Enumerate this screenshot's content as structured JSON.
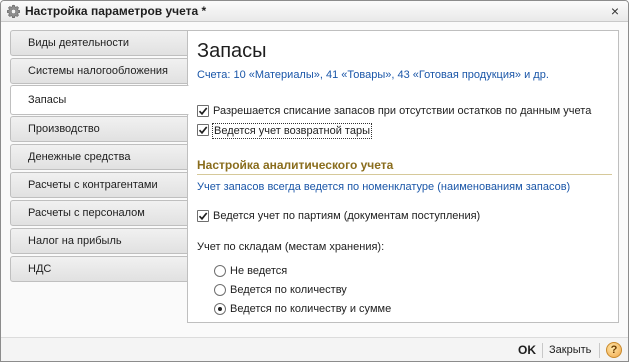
{
  "window": {
    "title": "Настройка параметров учета *",
    "close_glyph": "×"
  },
  "tabs": [
    {
      "label": "Виды деятельности",
      "active": false
    },
    {
      "label": "Системы налогообложения",
      "active": false
    },
    {
      "label": "Запасы",
      "active": true
    },
    {
      "label": "Производство",
      "active": false
    },
    {
      "label": "Денежные средства",
      "active": false
    },
    {
      "label": "Расчеты с контрагентами",
      "active": false
    },
    {
      "label": "Расчеты с персоналом",
      "active": false
    },
    {
      "label": "Налог на прибыль",
      "active": false
    },
    {
      "label": "НДС",
      "active": false
    }
  ],
  "panel": {
    "title": "Запасы",
    "accounts_link": "Счета: 10 «Материалы», 41 «Товары», 43 «Готовая продукция» и др.",
    "checkbox_write_off": {
      "label": "Разрешается списание запасов при отсутствии остатков по данным учета",
      "checked": true
    },
    "checkbox_returnable": {
      "label": "Ведется учет возвратной тары",
      "checked": true
    },
    "section_title": "Настройка аналитического учета",
    "info_text": "Учет запасов всегда ведется по номенклатуре (наименованиям запасов)",
    "checkbox_batches": {
      "label": "Ведется учет по партиям (документам поступления)",
      "checked": true
    },
    "warehouse_group_label": "Учет по складам (местам хранения):",
    "warehouse_options": [
      {
        "label": "Не ведется",
        "selected": false
      },
      {
        "label": "Ведется по количеству",
        "selected": false
      },
      {
        "label": "Ведется по количеству и сумме",
        "selected": true
      }
    ]
  },
  "footer": {
    "ok_label": "OK",
    "close_label": "Закрыть",
    "help_glyph": "?"
  },
  "colors": {
    "link": "#1a56a8",
    "section_title": "#8a6d1d"
  },
  "icons": {
    "title": "gear-icon",
    "help": "help-icon"
  }
}
